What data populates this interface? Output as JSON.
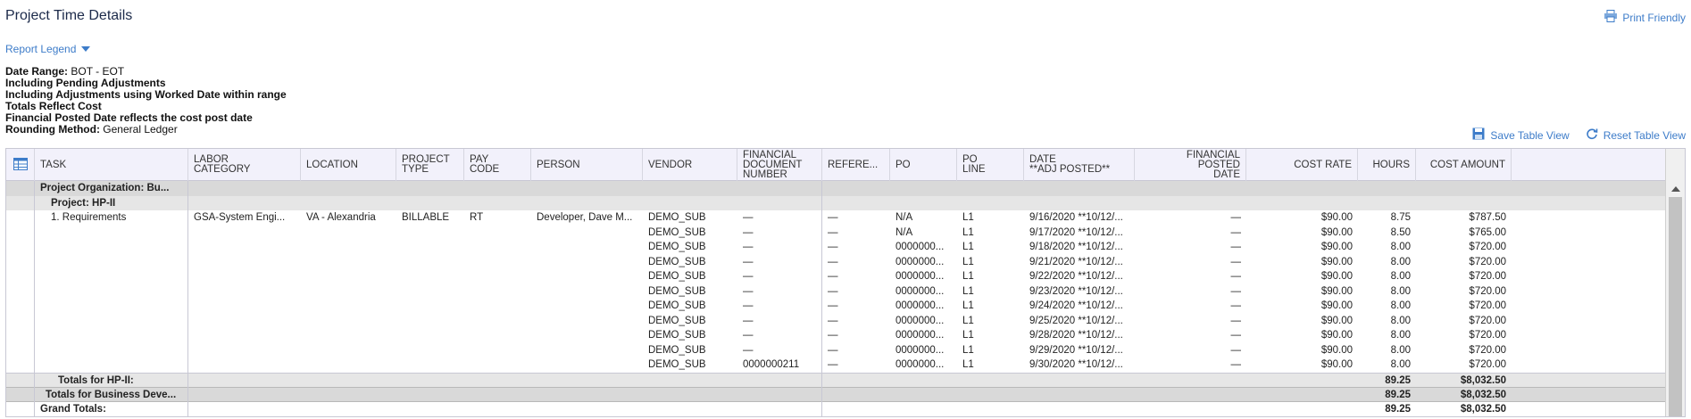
{
  "page": {
    "title": "Project Time Details",
    "print_label": "Print Friendly"
  },
  "legend": {
    "label": "Report Legend"
  },
  "criteria": [
    {
      "label": "Date Range:",
      "value": " BOT - EOT"
    },
    {
      "label": "Including Pending Adjustments",
      "value": ""
    },
    {
      "label": "Including Adjustments using Worked Date within range",
      "value": ""
    },
    {
      "label": "Totals Reflect Cost",
      "value": ""
    },
    {
      "label": "Financial Posted Date reflects the cost post date",
      "value": ""
    },
    {
      "label": "Rounding Method:",
      "value": " General Ledger"
    }
  ],
  "table_actions": {
    "save_label": "Save Table View",
    "reset_label": "Reset Table View"
  },
  "columns": {
    "task": "TASK",
    "labor": "LABOR\nCATEGORY",
    "location": "LOCATION",
    "project_type": "PROJECT\nTYPE",
    "pay_code": "PAY\nCODE",
    "person": "PERSON",
    "vendor": "VENDOR",
    "fin_doc": "FINANCIAL\nDOCUMENT\nNUMBER",
    "reference": "REFERE...",
    "po": "PO",
    "po_line": "PO\nLINE",
    "date": "DATE\n**ADJ POSTED**",
    "fin_posted": "FINANCIAL\nPOSTED\nDATE",
    "cost_rate": "COST RATE",
    "hours": "HOURS",
    "cost_amount": "COST AMOUNT"
  },
  "groups": {
    "org_label": "Project Organization: Bu...",
    "project_label": "Project: HP-II"
  },
  "task_info": {
    "task": "1. Requirements",
    "labor": "GSA-System Engi...",
    "location": "VA - Alexandria",
    "project_type": "BILLABLE",
    "pay_code": "RT",
    "person": "Developer, Dave M..."
  },
  "rows": [
    {
      "vendor": "DEMO_SUB",
      "fin_doc": "—",
      "reference": "—",
      "po": "N/A",
      "po_line": "L1",
      "date": "9/16/2020 **10/12/...",
      "fin_posted": "—",
      "cost_rate": "$90.00",
      "hours": "8.75",
      "cost_amount": "$787.50"
    },
    {
      "vendor": "DEMO_SUB",
      "fin_doc": "—",
      "reference": "—",
      "po": "N/A",
      "po_line": "L1",
      "date": "9/17/2020 **10/12/...",
      "fin_posted": "—",
      "cost_rate": "$90.00",
      "hours": "8.50",
      "cost_amount": "$765.00"
    },
    {
      "vendor": "DEMO_SUB",
      "fin_doc": "—",
      "reference": "—",
      "po": "0000000...",
      "po_line": "L1",
      "date": "9/18/2020 **10/12/...",
      "fin_posted": "—",
      "cost_rate": "$90.00",
      "hours": "8.00",
      "cost_amount": "$720.00"
    },
    {
      "vendor": "DEMO_SUB",
      "fin_doc": "—",
      "reference": "—",
      "po": "0000000...",
      "po_line": "L1",
      "date": "9/21/2020 **10/12/...",
      "fin_posted": "—",
      "cost_rate": "$90.00",
      "hours": "8.00",
      "cost_amount": "$720.00"
    },
    {
      "vendor": "DEMO_SUB",
      "fin_doc": "—",
      "reference": "—",
      "po": "0000000...",
      "po_line": "L1",
      "date": "9/22/2020 **10/12/...",
      "fin_posted": "—",
      "cost_rate": "$90.00",
      "hours": "8.00",
      "cost_amount": "$720.00"
    },
    {
      "vendor": "DEMO_SUB",
      "fin_doc": "—",
      "reference": "—",
      "po": "0000000...",
      "po_line": "L1",
      "date": "9/23/2020 **10/12/...",
      "fin_posted": "—",
      "cost_rate": "$90.00",
      "hours": "8.00",
      "cost_amount": "$720.00"
    },
    {
      "vendor": "DEMO_SUB",
      "fin_doc": "—",
      "reference": "—",
      "po": "0000000...",
      "po_line": "L1",
      "date": "9/24/2020 **10/12/...",
      "fin_posted": "—",
      "cost_rate": "$90.00",
      "hours": "8.00",
      "cost_amount": "$720.00"
    },
    {
      "vendor": "DEMO_SUB",
      "fin_doc": "—",
      "reference": "—",
      "po": "0000000...",
      "po_line": "L1",
      "date": "9/25/2020 **10/12/...",
      "fin_posted": "—",
      "cost_rate": "$90.00",
      "hours": "8.00",
      "cost_amount": "$720.00"
    },
    {
      "vendor": "DEMO_SUB",
      "fin_doc": "—",
      "reference": "—",
      "po": "0000000...",
      "po_line": "L1",
      "date": "9/28/2020 **10/12/...",
      "fin_posted": "—",
      "cost_rate": "$90.00",
      "hours": "8.00",
      "cost_amount": "$720.00"
    },
    {
      "vendor": "DEMO_SUB",
      "fin_doc": "—",
      "reference": "—",
      "po": "0000000...",
      "po_line": "L1",
      "date": "9/29/2020 **10/12/...",
      "fin_posted": "—",
      "cost_rate": "$90.00",
      "hours": "8.00",
      "cost_amount": "$720.00"
    },
    {
      "vendor": "DEMO_SUB",
      "fin_doc": "0000000211",
      "reference": "—",
      "po": "0000000...",
      "po_line": "L1",
      "date": "9/30/2020 **10/12/...",
      "fin_posted": "—",
      "cost_rate": "$90.00",
      "hours": "8.00",
      "cost_amount": "$720.00"
    }
  ],
  "totals": [
    {
      "label": "Totals for HP-II:",
      "hours": "89.25",
      "cost_amount": "$8,032.50"
    },
    {
      "label": "Totals for Business Deve...",
      "hours": "89.25",
      "cost_amount": "$8,032.50"
    },
    {
      "label": "Grand Totals:",
      "hours": "89.25",
      "cost_amount": "$8,032.50"
    }
  ]
}
